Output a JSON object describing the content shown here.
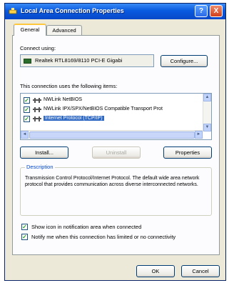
{
  "window": {
    "title": "Local Area Connection Properties",
    "help_label": "?",
    "close_label": "X"
  },
  "tabs": [
    {
      "label": "General",
      "active": true
    },
    {
      "label": "Advanced",
      "active": false
    }
  ],
  "connect_using": {
    "label": "Connect using:",
    "adapter": "Realtek RTL8169/8110 PCI-E Gigabi",
    "configure_label": "Configure..."
  },
  "components": {
    "label": "This connection uses the following items:",
    "items": [
      {
        "label": "NWLink NetBIOS",
        "checked": true,
        "selected": false
      },
      {
        "label": "NWLink IPX/SPX/NetBIOS Compatible Transport Prot",
        "checked": true,
        "selected": false
      },
      {
        "label": "Internet Protocol (TCP/IP)",
        "checked": true,
        "selected": true
      }
    ],
    "scroll_up": "▲",
    "scroll_down": "▼",
    "scroll_left": "◄",
    "scroll_right": "►"
  },
  "buttons": {
    "install": "Install...",
    "uninstall": "Uninstall",
    "properties": "Properties",
    "ok": "OK",
    "cancel": "Cancel"
  },
  "description": {
    "title": "Description",
    "text": "Transmission Control Protocol/Internet Protocol. The default wide area network protocol that provides communication across diverse interconnected networks."
  },
  "options": [
    {
      "label": "Show icon in notification area when connected",
      "checked": true
    },
    {
      "label": "Notify me when this connection has limited or no connectivity",
      "checked": true
    }
  ],
  "colors": {
    "titlebar": "#0a5ae0",
    "selection": "#316ac5",
    "check": "#21a121"
  }
}
